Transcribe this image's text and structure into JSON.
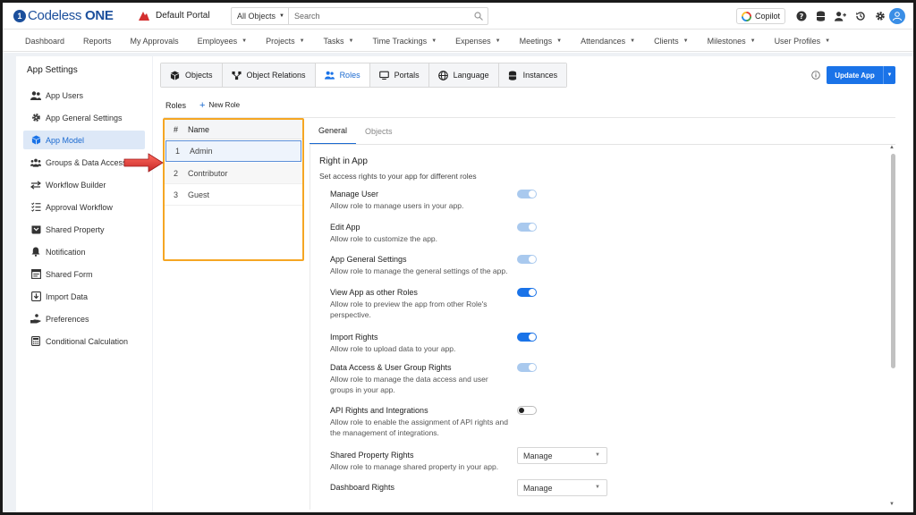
{
  "header": {
    "logo_mark": "1",
    "logo_text_light": "Codeless ",
    "logo_text_bold": "ONE",
    "portal_name": "Default Portal",
    "search_scope": "All Objects",
    "search_placeholder": "Search",
    "copilot_label": "Copilot"
  },
  "nav": {
    "items": [
      {
        "label": "Dashboard",
        "dropdown": false
      },
      {
        "label": "Reports",
        "dropdown": false
      },
      {
        "label": "My Approvals",
        "dropdown": false
      },
      {
        "label": "Employees",
        "dropdown": true
      },
      {
        "label": "Projects",
        "dropdown": true
      },
      {
        "label": "Tasks",
        "dropdown": true
      },
      {
        "label": "Time Trackings",
        "dropdown": true
      },
      {
        "label": "Expenses",
        "dropdown": true
      },
      {
        "label": "Meetings",
        "dropdown": true
      },
      {
        "label": "Attendances",
        "dropdown": true
      },
      {
        "label": "Clients",
        "dropdown": true
      },
      {
        "label": "Milestones",
        "dropdown": true
      },
      {
        "label": "User Profiles",
        "dropdown": true
      }
    ]
  },
  "sidebar": {
    "title": "App Settings",
    "items": [
      {
        "label": "App Users",
        "icon": "users-icon",
        "active": false
      },
      {
        "label": "App General Settings",
        "icon": "gear-icon",
        "active": false
      },
      {
        "label": "App Model",
        "icon": "cube-icon",
        "active": true
      },
      {
        "label": "Groups & Data Access",
        "icon": "group-icon",
        "active": false
      },
      {
        "label": "Workflow Builder",
        "icon": "arrows-icon",
        "active": false
      },
      {
        "label": "Approval Workflow",
        "icon": "checklist-icon",
        "active": false
      },
      {
        "label": "Shared Property",
        "icon": "box-icon",
        "active": false
      },
      {
        "label": "Notification",
        "icon": "bell-icon",
        "active": false
      },
      {
        "label": "Shared Form",
        "icon": "form-icon",
        "active": false
      },
      {
        "label": "Import Data",
        "icon": "import-icon",
        "active": false
      },
      {
        "label": "Preferences",
        "icon": "hand-icon",
        "active": false
      },
      {
        "label": "Conditional Calculation",
        "icon": "calculator-icon",
        "active": false
      }
    ]
  },
  "tabs": [
    {
      "label": "Objects",
      "icon": "cube-icon",
      "active": false
    },
    {
      "label": "Object Relations",
      "icon": "relations-icon",
      "active": false
    },
    {
      "label": "Roles",
      "icon": "users-icon",
      "active": true
    },
    {
      "label": "Portals",
      "icon": "monitor-icon",
      "active": false
    },
    {
      "label": "Language",
      "icon": "globe-icon",
      "active": false
    },
    {
      "label": "Instances",
      "icon": "database-icon",
      "active": false
    }
  ],
  "update_button": "Update App",
  "roles": {
    "label": "Roles",
    "new_role": "New Role",
    "columns": [
      "#",
      "Name"
    ],
    "rows": [
      {
        "num": "1",
        "name": "Admin",
        "selected": true
      },
      {
        "num": "2",
        "name": "Contributor",
        "selected": false
      },
      {
        "num": "3",
        "name": "Guest",
        "selected": false
      }
    ]
  },
  "sub_tabs": [
    {
      "label": "General",
      "active": true
    },
    {
      "label": "Objects",
      "active": false
    }
  ],
  "right_in_app": {
    "title": "Right in App",
    "subtitle": "Set access rights to your app for different roles",
    "permissions": [
      {
        "title": "Manage User",
        "desc": "Allow role to manage users in your app.",
        "control": "toggle",
        "state": "light"
      },
      {
        "title": "Edit App",
        "desc": "Allow role to customize the app.",
        "control": "toggle",
        "state": "light"
      },
      {
        "title": "App General Settings",
        "desc": "Allow role to manage the general settings of the app.",
        "control": "toggle",
        "state": "light"
      },
      {
        "title": "View App as other Roles",
        "desc": "Allow role to preview the app from other Role's perspective.",
        "control": "toggle",
        "state": "on"
      },
      {
        "title": "Import Rights",
        "desc": "Allow role to upload data to your app.",
        "control": "toggle",
        "state": "on"
      },
      {
        "title": "Data Access & User Group Rights",
        "desc": "Allow role to manage the data access and user groups in your app.",
        "control": "toggle",
        "state": "light"
      },
      {
        "title": "API Rights and Integrations",
        "desc": "Allow role to enable the assignment of API rights and the management of integrations.",
        "control": "toggle",
        "state": "off"
      },
      {
        "title": "Shared Property Rights",
        "desc": "Allow role to manage shared property in your app.",
        "control": "select",
        "value": "Manage"
      },
      {
        "title": "Dashboard Rights",
        "desc": "",
        "control": "select",
        "value": "Manage"
      }
    ]
  },
  "colors": {
    "primary": "#1a73e8",
    "active_bg": "#dde8f7",
    "highlight_border": "#f5a623",
    "arrow": "#e53935"
  }
}
